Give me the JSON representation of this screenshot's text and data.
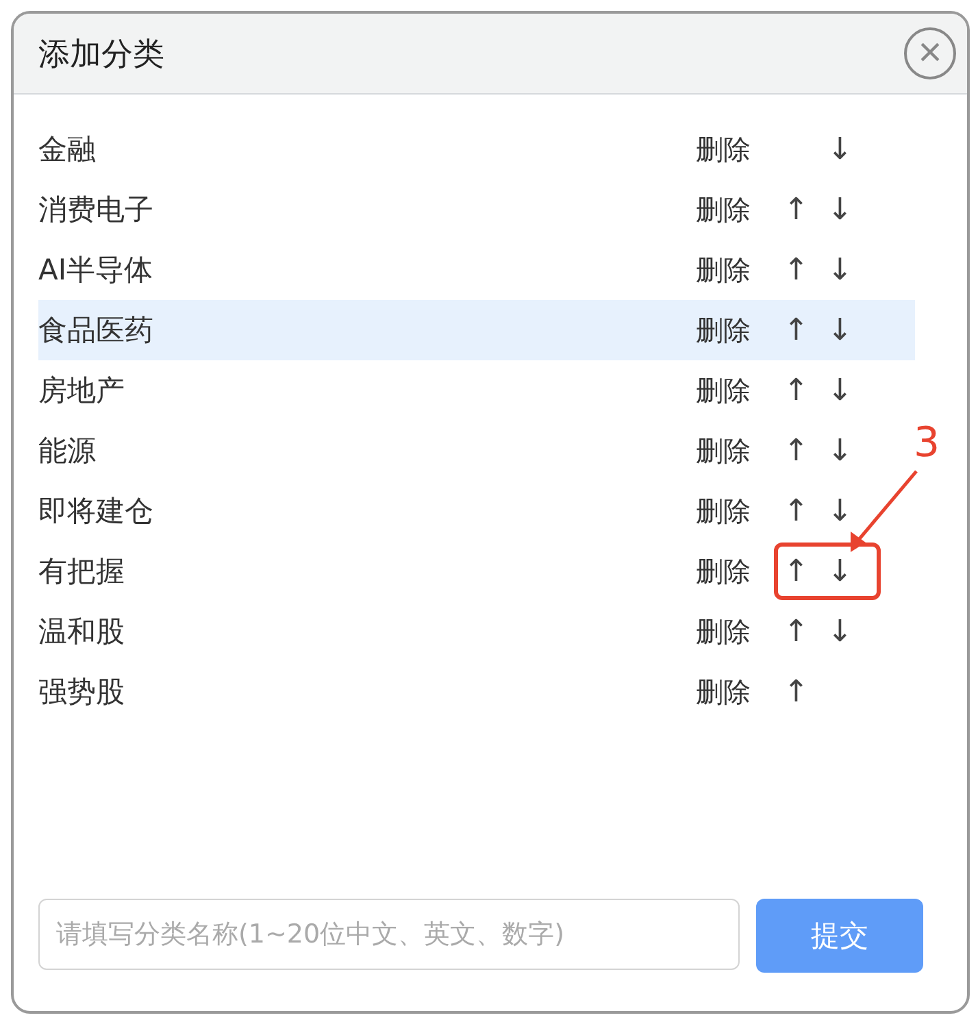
{
  "dialog": {
    "title": "添加分类",
    "close": "×"
  },
  "categories": [
    {
      "name": "金融",
      "delete": "删除",
      "down": "↓",
      "selected": false,
      "marked": false
    },
    {
      "name": "消费电子",
      "delete": "删除",
      "up": "↑",
      "down": "↓",
      "selected": false,
      "marked": false
    },
    {
      "name": "AI半导体",
      "delete": "删除",
      "up": "↑",
      "down": "↓",
      "selected": false,
      "marked": false
    },
    {
      "name": "食品医药",
      "delete": "删除",
      "up": "↑",
      "down": "↓",
      "selected": true,
      "marked": false
    },
    {
      "name": "房地产",
      "delete": "删除",
      "up": "↑",
      "down": "↓",
      "selected": false,
      "marked": false
    },
    {
      "name": "能源",
      "delete": "删除",
      "up": "↑",
      "down": "↓",
      "selected": false,
      "marked": false
    },
    {
      "name": "即将建仓",
      "delete": "删除",
      "up": "↑",
      "down": "↓",
      "selected": false,
      "marked": false
    },
    {
      "name": "有把握",
      "delete": "删除",
      "up": "↑",
      "down": "↓",
      "selected": false,
      "marked": true
    },
    {
      "name": "温和股",
      "delete": "删除",
      "up": "↑",
      "down": "↓",
      "selected": false,
      "marked": false
    },
    {
      "name": "强势股",
      "delete": "删除",
      "up": "↑",
      "selected": false,
      "marked": false
    }
  ],
  "annotation": {
    "label": "3"
  },
  "form": {
    "placeholder": "请填写分类名称(1~20位中文、英文、数字)",
    "submit": "提交"
  }
}
